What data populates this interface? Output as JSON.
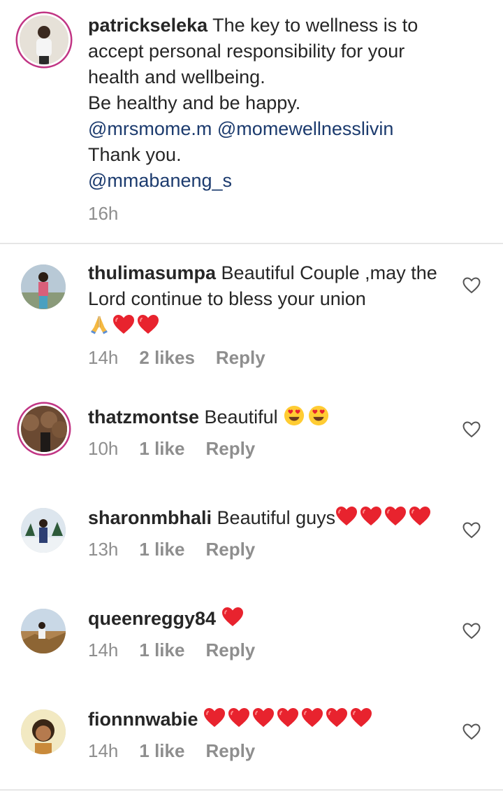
{
  "caption": {
    "username": "patrickseleka",
    "lines": [
      "The key to wellness is to",
      "accept personal responsibility for your",
      "health and wellbeing.",
      "Be healthy and be happy."
    ],
    "mentions1": "@mrsmome.m @momewellnesslivin",
    "thanks": "Thank you.",
    "mentions2": "@mmabaneng_s",
    "time": "16h"
  },
  "comments": [
    {
      "username": "thulimasumpa",
      "text": "Beautiful Couple ,may the",
      "text2": "Lord continue to bless your union",
      "time": "14h",
      "likes": "2 likes",
      "reply": "Reply",
      "emojis": "🙏❤️❤️"
    },
    {
      "username": "thatzmontse",
      "text": "Beautiful",
      "time": "10h",
      "likes": "1 like",
      "reply": "Reply",
      "emojis": "😍😍"
    },
    {
      "username": "sharonmbhali",
      "text": "Beautiful guys",
      "time": "13h",
      "likes": "1 like",
      "reply": "Reply",
      "emojis": "❤️❤️❤️❤️"
    },
    {
      "username": "queenreggy84",
      "text": "",
      "time": "14h",
      "likes": "1 like",
      "reply": "Reply",
      "emojis": "❤️"
    },
    {
      "username": "fionnnwabie",
      "text": "",
      "time": "14h",
      "likes": "1 like",
      "reply": "Reply",
      "emojis": "❤️❤️❤️❤️❤️❤️❤️"
    }
  ],
  "colors": {
    "mention": "#1c3b6e",
    "meta": "#8e8e8e",
    "heart": "#e8232e",
    "ring": "#c13584"
  }
}
